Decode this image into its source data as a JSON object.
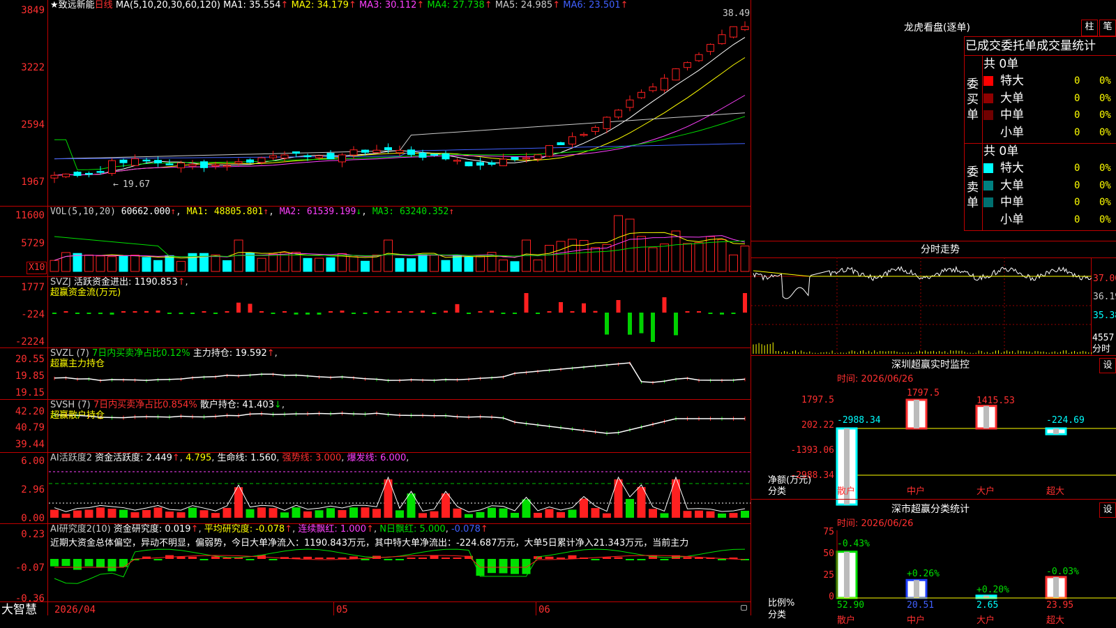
{
  "main_chart": {
    "star": "★",
    "stock_name": "致远新能",
    "period": "日线",
    "ma_header": "MA(5,10,20,30,60,120)",
    "ma_values": [
      {
        "label": "MA1:",
        "value": "35.554",
        "arrow": "↑",
        "color": "#ffffff"
      },
      {
        "label": "MA2:",
        "value": "34.179",
        "arrow": "↑",
        "color": "#ffff00"
      },
      {
        "label": "MA3:",
        "value": "30.112",
        "arrow": "↑",
        "color": "#ff40ff"
      },
      {
        "label": "MA4:",
        "value": "27.738",
        "arrow": "↑",
        "color": "#00e000"
      },
      {
        "label": "MA5:",
        "value": "24.985",
        "arrow": "↑",
        "color": "#cccccc"
      },
      {
        "label": "MA6:",
        "value": "23.501",
        "arrow": "↑",
        "color": "#4060ff"
      }
    ],
    "y_ticks": [
      "3849",
      "3222",
      "2594",
      "1967"
    ],
    "high_label": "38.49",
    "low_label": "19.67"
  },
  "volume_chart": {
    "header": "VOL(5,10,20)",
    "vol": "60662.000",
    "ma1": "MA1: 48805.801",
    "ma2": "MA2: 61539.199",
    "ma3": "MA3: 63240.352",
    "y_ticks": [
      "11600",
      "5729"
    ],
    "multiplier": "X10"
  },
  "svzj": {
    "name": "SVZJ",
    "label": "活跃资金进出:",
    "value": "1190.853",
    "subtitle": "超赢资金流(万元)",
    "y_ticks": [
      "1777",
      "-224",
      "-2224"
    ]
  },
  "svzl": {
    "name": "SVZL",
    "param": "(7)",
    "ratio_label": "7日内买卖净占比0.12%",
    "label": "主力持仓:",
    "value": "19.592",
    "subtitle": "超赢主力持仓",
    "y_ticks": [
      "20.55",
      "19.85",
      "19.15"
    ]
  },
  "svsh": {
    "name": "SVSH",
    "param": "(7)",
    "ratio_label": "7日内买卖净占比0.854%",
    "label": "散户持仓:",
    "value": "41.403",
    "subtitle": "超赢散户持仓",
    "y_ticks": [
      "42.20",
      "40.79",
      "39.44"
    ]
  },
  "ai_active": {
    "name": "AI活跃度2",
    "label": "资金活跃度:",
    "v1": "2.449",
    "v2": "4.795",
    "life_label": "生命线:",
    "life": "1.560",
    "strong": "强势线: 3.000",
    "burst": "爆发线: 6.000",
    "y_ticks": [
      "6.00",
      "2.96",
      "0.00"
    ]
  },
  "ai_research": {
    "name": "AI研究度2(10)",
    "label": "资金研究度:",
    "value": "0.019",
    "avg": "平均研究度: -0.078",
    "cont": "连续飘红: 1.000",
    "nday": "N日飘红: 5.000",
    "last": "-0.078",
    "comment": "近期大资金总体偏空，异动不明显，偏弱势，今日大单净流入：1190.843万元，其中特大单净流出：-224.687万元，大单5日累计净入21.343万元，当前主力",
    "y_ticks": [
      "0.23",
      "-0.07",
      "-0.36"
    ]
  },
  "x_axis": {
    "brand": "大智慧",
    "labels": [
      "2026/04",
      "05",
      "06"
    ]
  },
  "dragon_tiger": {
    "title": "龙虎看盘(逐单)",
    "btn1": "柱",
    "btn2": "笔",
    "header": "已成交委托单成交量统计",
    "buy_label": "委买单",
    "sell_label": "委卖单",
    "buy_total": "共 0单",
    "sell_total": "共 0单",
    "buy_rows": [
      {
        "name": "特大",
        "count": "0",
        "pct": "0%",
        "color": "#ff0000"
      },
      {
        "name": "大单",
        "count": "0",
        "pct": "0%",
        "color": "#900000"
      },
      {
        "name": "中单",
        "count": "0",
        "pct": "0%",
        "color": "#700000"
      },
      {
        "name": "小单",
        "count": "0",
        "pct": "0%",
        "color": "#000000"
      }
    ],
    "sell_rows": [
      {
        "name": "特大",
        "count": "0",
        "pct": "0%",
        "color": "#00ffff"
      },
      {
        "name": "大单",
        "count": "0",
        "pct": "0%",
        "color": "#008080"
      },
      {
        "name": "中单",
        "count": "0",
        "pct": "0%",
        "color": "#007070"
      },
      {
        "name": "小单",
        "count": "0",
        "pct": "0%",
        "color": "#000000"
      }
    ]
  },
  "intraday": {
    "title": "分时走势",
    "y_ticks": [
      "37.00",
      "36.19",
      "35.38"
    ],
    "vol_label": "4557",
    "vol_unit": "分时"
  },
  "sz_monitor": {
    "title": "深圳超赢实时监控",
    "btn": "设",
    "time": "时间: 2026/06/26",
    "y_ticks": [
      "1797.5",
      "202.22",
      "-1393.06",
      "-2988.34"
    ],
    "unit": "净额(万元)",
    "cat_label": "分类",
    "categories": [
      "散户",
      "中户",
      "大户",
      "超大"
    ],
    "values": [
      "-2988.34",
      "1797.5",
      "1415.53",
      "-224.69"
    ]
  },
  "sz_category": {
    "title": "深市超赢分类统计",
    "btn": "设",
    "time": "时间: 2026/06/26",
    "y_ticks": [
      "75",
      "50",
      "25",
      "0"
    ],
    "unit": "比例%",
    "cat_label": "分类",
    "categories": [
      "散户",
      "中户",
      "大户",
      "超大"
    ],
    "changes": [
      "-0.43%",
      "+0.26%",
      "+0.20%",
      "-0.03%"
    ],
    "values": [
      "52.90",
      "20.51",
      "2.65",
      "23.95"
    ]
  }
}
